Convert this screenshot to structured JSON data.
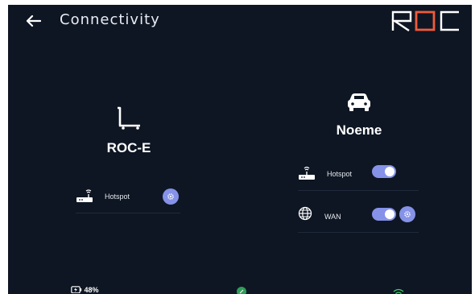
{
  "header": {
    "title": "Connectivity",
    "logo_text": "ROC",
    "accent_color": "#f05a3c"
  },
  "devices": {
    "left": {
      "icon": "cart-icon",
      "name": "ROC-E",
      "rows": [
        {
          "icon": "router-icon",
          "label": "Hotspot",
          "has_toggle": false,
          "has_settings": true
        }
      ]
    },
    "right": {
      "icon": "car-icon",
      "name": "Noeme",
      "rows": [
        {
          "icon": "router-icon",
          "label": "Hotspot",
          "has_toggle": true,
          "toggle_on": true,
          "has_settings": false
        },
        {
          "icon": "globe-icon",
          "label": "WAN",
          "has_toggle": true,
          "toggle_on": true,
          "has_settings": true
        }
      ]
    }
  },
  "status_bar": {
    "battery_text": "48%",
    "center_icon": "location-icon",
    "right_icon": "wifi-icon",
    "center_color": "#2e9e58",
    "wifi_color": "#3fcf6a"
  },
  "colors": {
    "background": "#0e1623",
    "toggle": "#8592e8"
  }
}
